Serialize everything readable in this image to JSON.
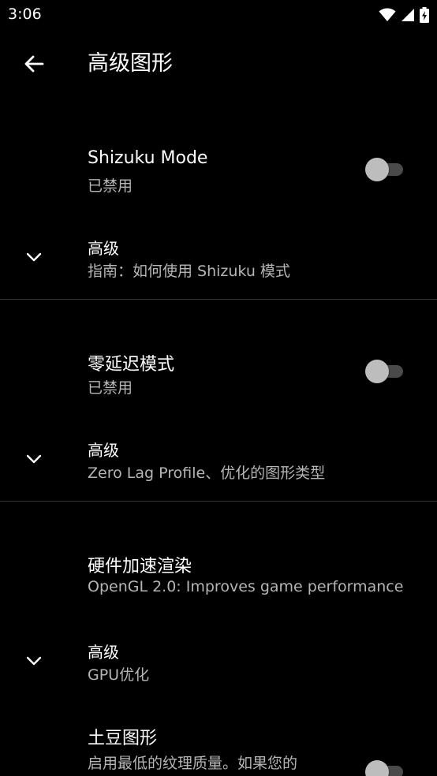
{
  "status_bar": {
    "time": "3:06"
  },
  "app_bar": {
    "title": "高级图形"
  },
  "sections": [
    {
      "title": "Shizuku Mode",
      "subtitle": "已禁用",
      "switch_on": false,
      "advanced_title": "高级",
      "advanced_subtitle": "指南：如何使用 Shizuku 模式"
    },
    {
      "title": "零延迟模式",
      "subtitle": "已禁用",
      "switch_on": false,
      "advanced_title": "高级",
      "advanced_subtitle": "Zero Lag Profile、优化的图形类型"
    },
    {
      "title": "硬件加速渲染",
      "subtitle": "OpenGL 2.0: Improves game performance",
      "advanced_title": "高级",
      "advanced_subtitle": "GPU优化"
    },
    {
      "title": "土豆图形",
      "subtitle": "启用最低的纹理质量。如果您的",
      "switch_on": false
    }
  ],
  "icons": {
    "back": "arrow-back-icon",
    "expand": "chevron-down-icon",
    "wifi": "wifi-icon",
    "signal": "signal-icon",
    "battery": "battery-charging-icon"
  }
}
